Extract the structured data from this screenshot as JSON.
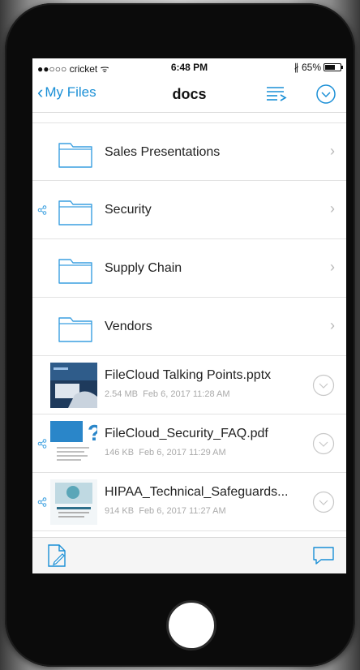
{
  "status_bar": {
    "carrier": "●●○○○ cricket ᯤ",
    "time": "6:48 PM",
    "battery_text": "∦ 65%",
    "battery_level": 0.65
  },
  "nav": {
    "back_label": "My Files",
    "title": "docs"
  },
  "folders": [
    {
      "name": "Sales Presentations",
      "shared": false
    },
    {
      "name": "Security",
      "shared": true
    },
    {
      "name": "Supply Chain",
      "shared": false
    },
    {
      "name": "Vendors",
      "shared": false
    }
  ],
  "files": [
    {
      "name": "FileCloud Talking Points.pptx",
      "size": "2.54 MB",
      "date": "Feb 6, 2017 11:28 AM",
      "shared": false,
      "thumb": "presentation-photo"
    },
    {
      "name": "FileCloud_Security_FAQ.pdf",
      "size": "146 KB",
      "date": "Feb 6, 2017 11:29 AM",
      "shared": true,
      "thumb": "faq-document"
    },
    {
      "name": "HIPAA_Technical_Safeguards...",
      "size": "914 KB",
      "date": "Feb 6, 2017 11:27 AM",
      "shared": true,
      "thumb": "hipaa-document"
    }
  ],
  "colors": {
    "accent": "#1a8fd6",
    "folder_stroke": "#3a9fe0"
  },
  "icons": {
    "folder": "folder-icon",
    "share": "share-icon",
    "action": "circle-chevron-down-icon",
    "new_document": "new-document-icon",
    "comment": "comment-icon"
  }
}
